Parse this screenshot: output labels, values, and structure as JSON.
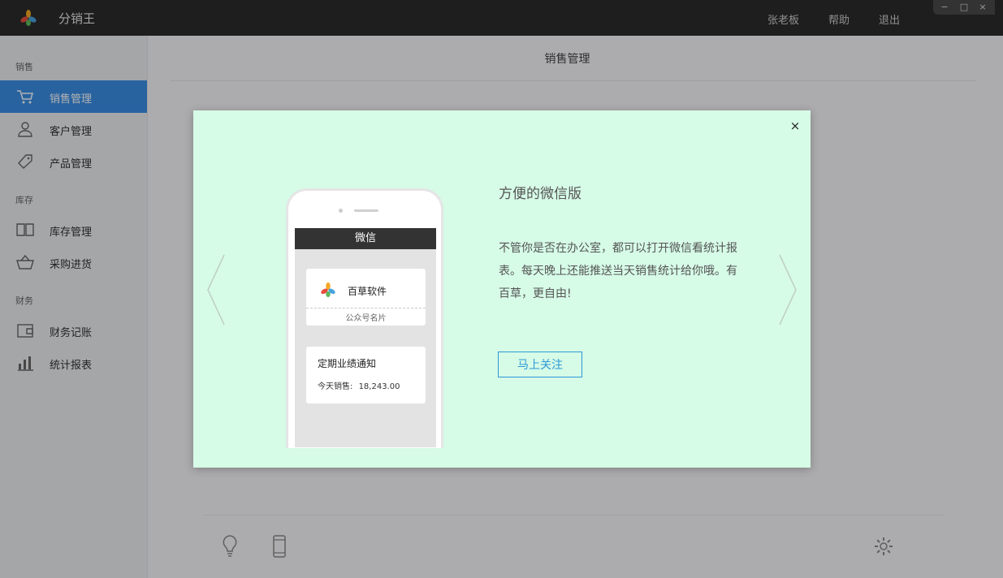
{
  "app": {
    "title": "分销王"
  },
  "top_nav": {
    "user": "张老板",
    "help": "帮助",
    "logout": "退出"
  },
  "window_controls": {
    "minimize": "−",
    "maximize": "□",
    "close": "×"
  },
  "sidebar": {
    "groups": [
      {
        "label": "销售",
        "items": [
          {
            "label": "销售管理",
            "icon": "cart-icon",
            "active": true
          },
          {
            "label": "客户管理",
            "icon": "user-icon"
          },
          {
            "label": "产品管理",
            "icon": "tag-icon"
          }
        ]
      },
      {
        "label": "库存",
        "items": [
          {
            "label": "库存管理",
            "icon": "book-icon"
          },
          {
            "label": "采购进货",
            "icon": "basket-icon"
          }
        ]
      },
      {
        "label": "财务",
        "items": [
          {
            "label": "财务记账",
            "icon": "wallet-icon"
          },
          {
            "label": "统计报表",
            "icon": "bar-chart-icon"
          }
        ]
      }
    ]
  },
  "main": {
    "title": "销售管理"
  },
  "modal": {
    "heading": "方便的微信版",
    "description": "不管你是否在办公室，都可以打开微信看统计报表。每天晚上还能推送当天销售统计给你哦。有百草，更自由!",
    "button_label": "马上关注",
    "close": "×",
    "phone": {
      "bar_title": "微信",
      "card_name": "百草软件",
      "card_sub": "公众号名片",
      "notice_title": "定期业绩通知",
      "sales_label": "今天销售:",
      "sales_value": "18,243.00"
    }
  },
  "colors": {
    "accent": "#3a8ee6",
    "modal_bg": "#d6fbe7",
    "button": "#2d99d6",
    "titlebar": "#2b2b2b"
  }
}
